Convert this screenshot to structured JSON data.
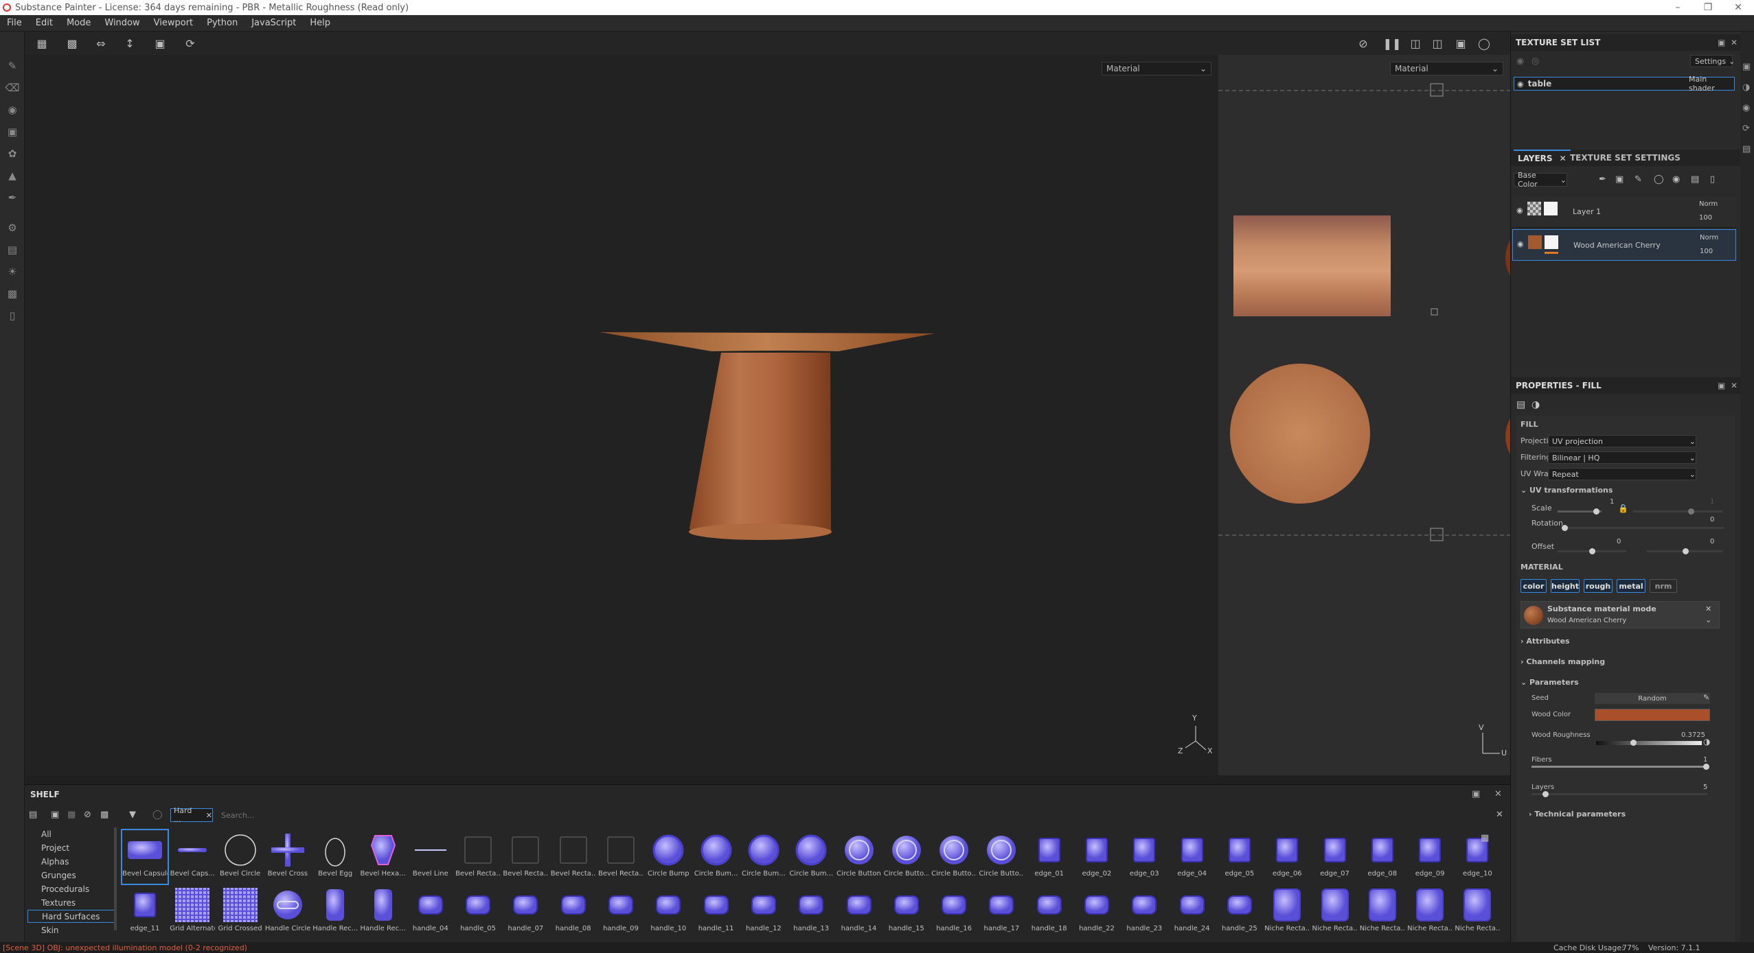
{
  "window": {
    "title": "Substance Painter - License: 364 days remaining - PBR - Metallic Roughness (Read only)"
  },
  "menu": [
    "File",
    "Edit",
    "Mode",
    "Window",
    "Viewport",
    "Python",
    "JavaScript",
    "Help"
  ],
  "viewport": {
    "left_mode": "Material",
    "right_mode": "Material",
    "axis_3d": {
      "y": "Y",
      "z": "Z",
      "x": "X"
    },
    "axis_2d": {
      "v": "V",
      "u": "U"
    }
  },
  "texture_set_list": {
    "title": "TEXTURE SET LIST",
    "settings_label": "Settings",
    "item_name": "table",
    "item_shader": "Main shader"
  },
  "layers": {
    "tab_layers": "LAYERS",
    "tab_settings": "TEXTURE SET SETTINGS",
    "channel": "Base Color",
    "items": [
      {
        "name": "Layer 1",
        "blend": "Norm",
        "opacity": "100"
      },
      {
        "name": "Wood American Cherry",
        "blend": "Norm",
        "opacity": "100"
      }
    ]
  },
  "properties": {
    "title": "PROPERTIES - FILL",
    "fill_heading": "FILL",
    "projection_label": "Projection",
    "projection_value": "UV projection",
    "filtering_label": "Filtering",
    "filtering_value": "Bilinear | HQ",
    "uvwrap_label": "UV Wrap",
    "uvwrap_value": "Repeat",
    "uv_transform_heading": "UV transformations",
    "scale_label": "Scale",
    "scale_value": "1",
    "scale_value2": "1",
    "rotation_label": "Rotation",
    "rotation_value": "0",
    "offset_label": "Offset",
    "offset_value1": "0",
    "offset_value2": "0",
    "material_heading": "MATERIAL",
    "chips": [
      "color",
      "height",
      "rough",
      "metal",
      "nrm"
    ],
    "mat_mode_label": "Substance material mode",
    "mat_name": "Wood American Cherry",
    "attributes": "Attributes",
    "channels_mapping": "Channels mapping",
    "parameters": "Parameters",
    "seed_label": "Seed",
    "seed_value": "Random",
    "wood_color_label": "Wood Color",
    "wood_color": "#a9502b",
    "wood_rough_label": "Wood Roughness",
    "wood_rough_value": "0.3725",
    "fibers_label": "Fibers",
    "fibers_value": "1",
    "layers_label": "Layers",
    "layers_value": "5",
    "technical": "Technical parameters"
  },
  "shelf": {
    "title": "SHELF",
    "filter_tag": "Hard ...",
    "search_placeholder": "Search...",
    "categories": [
      "All",
      "Project",
      "Alphas",
      "Grunges",
      "Procedurals",
      "Textures",
      "Hard Surfaces",
      "Skin"
    ],
    "selected_category": "Hard Surfaces",
    "row1": [
      {
        "label": "Bevel Capsule",
        "icon": "capsule-icon"
      },
      {
        "label": "Bevel Caps...",
        "icon": "capsule-small-icon"
      },
      {
        "label": "Bevel Circle",
        "icon": "circle-outline-icon"
      },
      {
        "label": "Bevel Cross",
        "icon": "cross-icon"
      },
      {
        "label": "Bevel Egg",
        "icon": "egg-icon"
      },
      {
        "label": "Bevel Hexa...",
        "icon": "hexagon-icon"
      },
      {
        "label": "Bevel Line",
        "icon": "line-icon"
      },
      {
        "label": "Bevel Recta...",
        "icon": "rect-outline-icon"
      },
      {
        "label": "Bevel Recta...",
        "icon": "rect-outline-icon"
      },
      {
        "label": "Bevel Recta...",
        "icon": "rect-outline-icon"
      },
      {
        "label": "Bevel Recta...",
        "icon": "rect-outline-icon"
      },
      {
        "label": "Circle Bump",
        "icon": "circle-bump-icon"
      },
      {
        "label": "Circle Bum...",
        "icon": "circle-bump-icon"
      },
      {
        "label": "Circle Bum...",
        "icon": "circle-bump-icon"
      },
      {
        "label": "Circle Bum...",
        "icon": "circle-bump-icon"
      },
      {
        "label": "Circle Button",
        "icon": "circle-button-icon"
      },
      {
        "label": "Circle Butto...",
        "icon": "circle-button-icon"
      },
      {
        "label": "Circle Butto...",
        "icon": "circle-button-icon"
      },
      {
        "label": "Circle Butto...",
        "icon": "circle-button-icon"
      },
      {
        "label": "edge_01",
        "icon": "edge-icon"
      },
      {
        "label": "edge_02",
        "icon": "edge-icon"
      },
      {
        "label": "edge_03",
        "icon": "edge-icon"
      },
      {
        "label": "edge_04",
        "icon": "edge-icon"
      },
      {
        "label": "edge_05",
        "icon": "edge-icon"
      },
      {
        "label": "edge_06",
        "icon": "edge-icon"
      },
      {
        "label": "edge_07",
        "icon": "edge-icon"
      },
      {
        "label": "edge_08",
        "icon": "edge-icon"
      },
      {
        "label": "edge_09",
        "icon": "edge-icon"
      },
      {
        "label": "edge_10",
        "icon": "edge-icon"
      }
    ],
    "row2": [
      {
        "label": "edge_11",
        "icon": "edge-icon"
      },
      {
        "label": "Grid Alternate",
        "icon": "grid-icon"
      },
      {
        "label": "Grid Crossed",
        "icon": "grid-icon"
      },
      {
        "label": "Handle Circle",
        "icon": "handle-circle-icon"
      },
      {
        "label": "Handle Rec...",
        "icon": "handle-rect-icon"
      },
      {
        "label": "Handle Rec...",
        "icon": "handle-rect-icon"
      },
      {
        "label": "handle_04",
        "icon": "handle-icon"
      },
      {
        "label": "handle_05",
        "icon": "handle-icon"
      },
      {
        "label": "handle_07",
        "icon": "handle-icon"
      },
      {
        "label": "handle_08",
        "icon": "handle-icon"
      },
      {
        "label": "handle_09",
        "icon": "handle-icon"
      },
      {
        "label": "handle_10",
        "icon": "handle-icon"
      },
      {
        "label": "handle_11",
        "icon": "handle-icon"
      },
      {
        "label": "handle_12",
        "icon": "handle-icon"
      },
      {
        "label": "handle_13",
        "icon": "handle-icon"
      },
      {
        "label": "handle_14",
        "icon": "handle-icon"
      },
      {
        "label": "handle_15",
        "icon": "handle-icon"
      },
      {
        "label": "handle_16",
        "icon": "handle-icon"
      },
      {
        "label": "handle_17",
        "icon": "handle-icon"
      },
      {
        "label": "handle_18",
        "icon": "handle-icon"
      },
      {
        "label": "handle_22",
        "icon": "handle-icon"
      },
      {
        "label": "handle_23",
        "icon": "handle-icon"
      },
      {
        "label": "handle_24",
        "icon": "handle-icon"
      },
      {
        "label": "handle_25",
        "icon": "handle-icon"
      },
      {
        "label": "Niche Recta...",
        "icon": "niche-icon"
      },
      {
        "label": "Niche Recta...",
        "icon": "niche-icon"
      },
      {
        "label": "Niche Recta...",
        "icon": "niche-icon"
      },
      {
        "label": "Niche Recta...",
        "icon": "niche-icon"
      },
      {
        "label": "Niche Recta...",
        "icon": "niche-icon"
      }
    ]
  },
  "status": {
    "error": "[Scene 3D] OBJ: unexpected illumination model (0-2 recognized)",
    "cache": "Cache Disk Usage:",
    "cache_value": "77%",
    "version": "Version: 7.1.1"
  },
  "colors": {
    "accent": "#3a8be0",
    "wood": "#b2663c",
    "error": "#e06040"
  }
}
